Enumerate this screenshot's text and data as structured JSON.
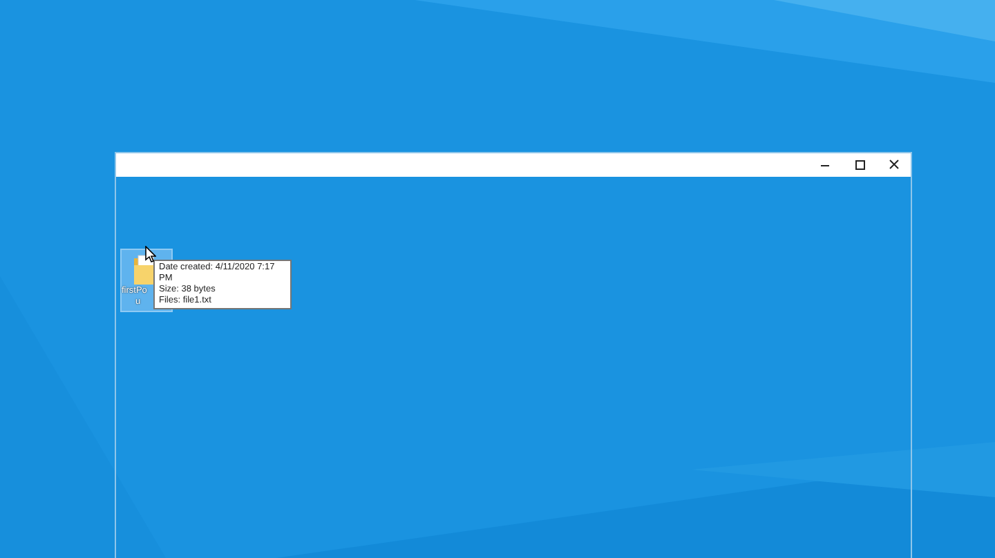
{
  "items": [
    {
      "label_lines": [
        "firstPo",
        "u"
      ],
      "selected": true
    }
  ],
  "tooltip": {
    "lines": [
      "Date created: 4/11/2020 7:17 PM",
      "Size: 38 bytes",
      "Files: file1.txt"
    ]
  }
}
